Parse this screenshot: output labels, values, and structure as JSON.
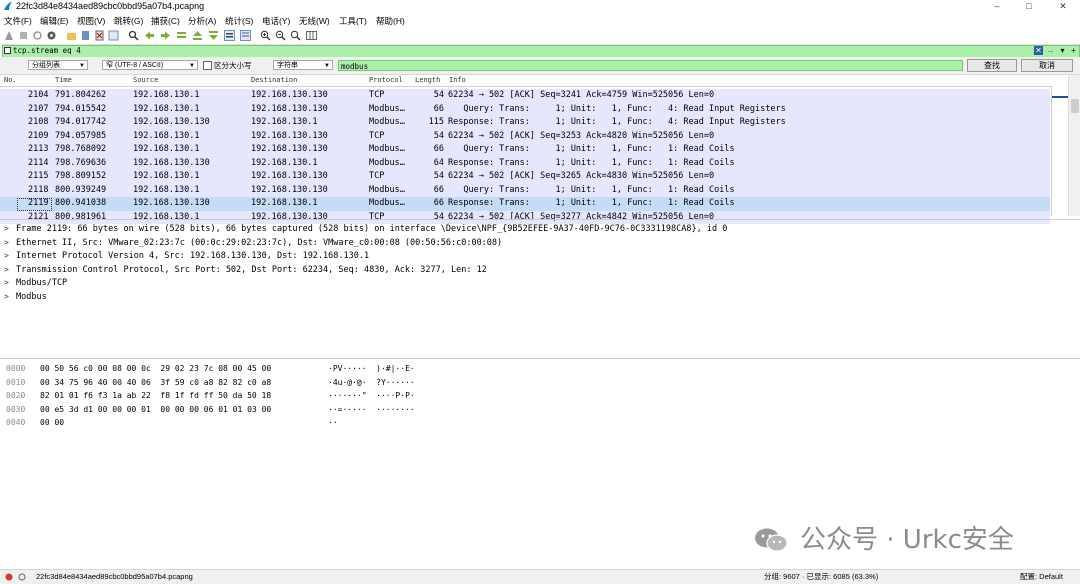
{
  "window": {
    "title": "22fc3d84e8434aed89cbc0bbd95a07b4.pcapng",
    "min": "–",
    "max": "□",
    "close": "✕"
  },
  "menu": [
    "文件(F)",
    "编辑(E)",
    "视图(V)",
    "跳转(G)",
    "捕获(C)",
    "分析(A)",
    "统计(S)",
    "电话(Y)",
    "无线(W)",
    "工具(T)",
    "帮助(H)"
  ],
  "filter": {
    "value": "tcp.stream eq 4"
  },
  "search": {
    "scope": "分组列表",
    "encoding": "窄 (UTF-8 / ASCII)",
    "case_label": "区分大小写",
    "type": "字符串",
    "query": "modbus",
    "find_button": "查找",
    "cancel_button": "取消"
  },
  "packet_list": {
    "headers": [
      "No.",
      "Time",
      "Source",
      "Destination",
      "Protocol",
      "Length",
      "Info"
    ],
    "rows": [
      {
        "no": "2104",
        "time": "791.804262",
        "src": "192.168.130.1",
        "dst": "192.168.130.130",
        "proto": "TCP",
        "len": "54",
        "info": "62234 → 502 [ACK] Seq=3241 Ack=4759 Win=525056 Len=0"
      },
      {
        "no": "2107",
        "time": "794.015542",
        "src": "192.168.130.1",
        "dst": "192.168.130.130",
        "proto": "Modbus…",
        "len": "66",
        "info": "   Query: Trans:     1; Unit:   1, Func:   4: Read Input Registers"
      },
      {
        "no": "2108",
        "time": "794.017742",
        "src": "192.168.130.130",
        "dst": "192.168.130.1",
        "proto": "Modbus…",
        "len": "115",
        "info": "Response: Trans:     1; Unit:   1, Func:   4: Read Input Registers"
      },
      {
        "no": "2109",
        "time": "794.057985",
        "src": "192.168.130.1",
        "dst": "192.168.130.130",
        "proto": "TCP",
        "len": "54",
        "info": "62234 → 502 [ACK] Seq=3253 Ack=4820 Win=525056 Len=0"
      },
      {
        "no": "2113",
        "time": "798.768092",
        "src": "192.168.130.1",
        "dst": "192.168.130.130",
        "proto": "Modbus…",
        "len": "66",
        "info": "   Query: Trans:     1; Unit:   1, Func:   1: Read Coils"
      },
      {
        "no": "2114",
        "time": "798.769636",
        "src": "192.168.130.130",
        "dst": "192.168.130.1",
        "proto": "Modbus…",
        "len": "64",
        "info": "Response: Trans:     1; Unit:   1, Func:   1: Read Coils"
      },
      {
        "no": "2115",
        "time": "798.809152",
        "src": "192.168.130.1",
        "dst": "192.168.130.130",
        "proto": "TCP",
        "len": "54",
        "info": "62234 → 502 [ACK] Seq=3265 Ack=4830 Win=525056 Len=0"
      },
      {
        "no": "2118",
        "time": "800.939249",
        "src": "192.168.130.1",
        "dst": "192.168.130.130",
        "proto": "Modbus…",
        "len": "66",
        "info": "   Query: Trans:     1; Unit:   1, Func:   1: Read Coils"
      },
      {
        "no": "2119",
        "time": "800.941038",
        "src": "192.168.130.130",
        "dst": "192.168.130.1",
        "proto": "Modbus…",
        "len": "66",
        "info": "Response: Trans:     1; Unit:   1, Func:   1: Read Coils"
      },
      {
        "no": "2121",
        "time": "800.981961",
        "src": "192.168.130.1",
        "dst": "192.168.130.130",
        "proto": "TCP",
        "len": "54",
        "info": "62234 → 502 [ACK] Seq=3277 Ack=4842 Win=525056 Len=0"
      }
    ]
  },
  "details": [
    "Frame 2119: 66 bytes on wire (528 bits), 66 bytes captured (528 bits) on interface \\Device\\NPF_{9B52EFEE-9A37-40FD-9C76-0C3331198CA8}, id 0",
    "Ethernet II, Src: VMware_02:23:7c (00:0c:29:02:23:7c), Dst: VMware_c0:00:08 (00:50:56:c0:00:08)",
    "Internet Protocol Version 4, Src: 192.168.130.130, Dst: 192.168.130.1",
    "Transmission Control Protocol, Src Port: 502, Dst Port: 62234, Seq: 4830, Ack: 3277, Len: 12",
    "Modbus/TCP",
    "Modbus"
  ],
  "bytes": [
    {
      "off": "0000",
      "hex": "00 50 56 c0 00 08 00 0c  29 02 23 7c 08 00 45 00",
      "ascii": "·PV·····  )·#|··E·"
    },
    {
      "off": "0010",
      "hex": "00 34 75 96 40 00 40 06  3f 59 c0 a8 82 82 c0 a8",
      "ascii": "·4u·@·@·  ?Y······"
    },
    {
      "off": "0020",
      "hex": "82 01 01 f6 f3 1a ab 22  f8 1f fd ff 50 da 50 18",
      "ascii": "·······\"  ····P·P·"
    },
    {
      "off": "0030",
      "hex": "00 e5 3d d1 00 00 00 01  00 00 00 06 01 01 03 00",
      "ascii": "··=·····  ········"
    },
    {
      "off": "0040",
      "hex": "00 00",
      "ascii": "··"
    }
  ],
  "watermark": "公众号 · Urkc安全",
  "status": {
    "file": "22fc3d84e8434aed89cbc0bbd95a07b4.pcapng",
    "packets": "分组: 9607 · 已显示: 6085 (63.3%)",
    "profile": "配置: Default"
  }
}
